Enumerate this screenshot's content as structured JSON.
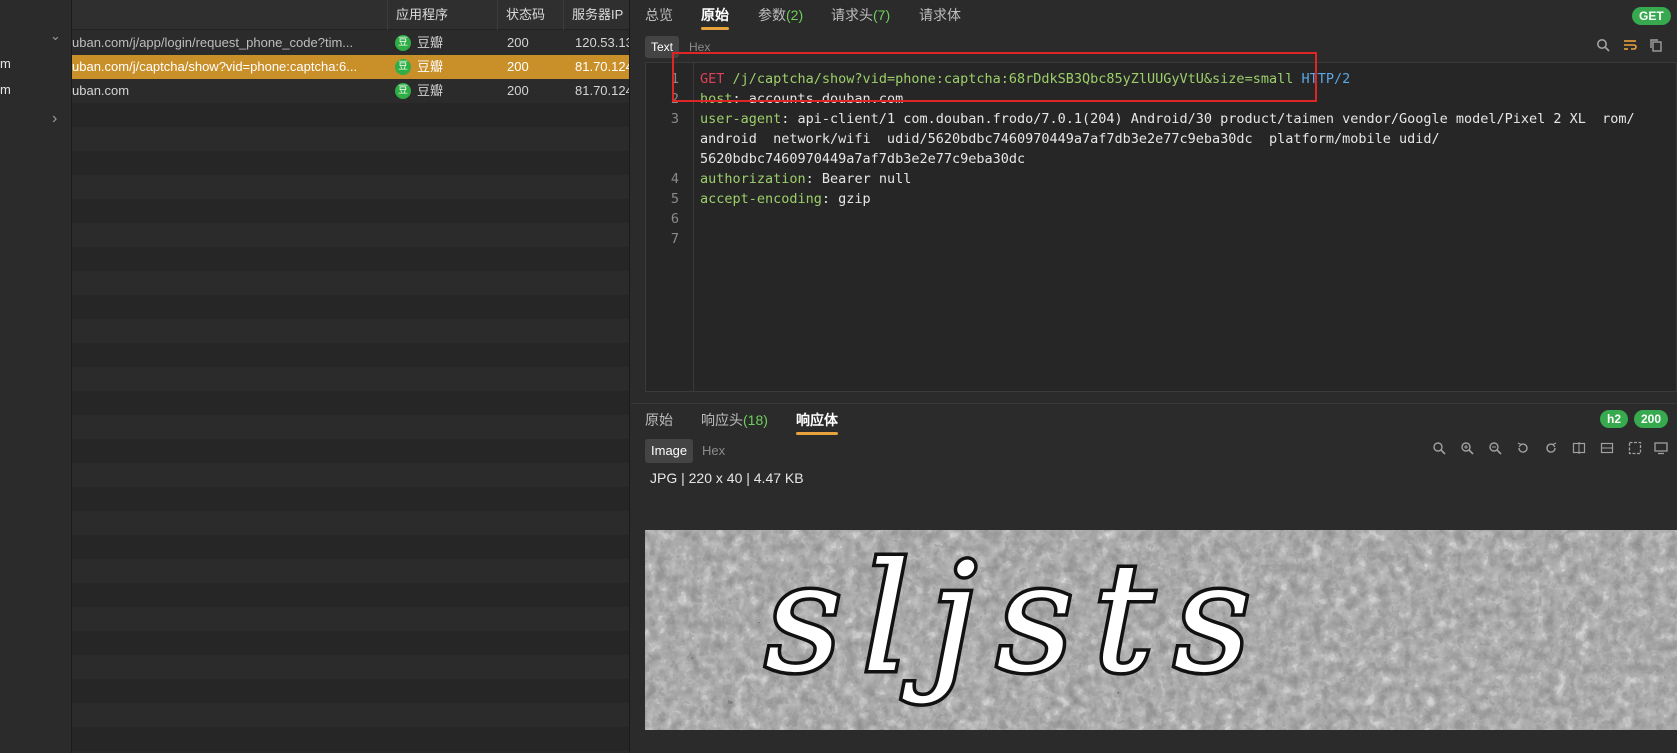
{
  "sidebar": {
    "chevron_down": "⌄",
    "chevron_right": "›",
    "fragments": [
      "m",
      "m"
    ]
  },
  "list": {
    "columns": [
      "应用程序",
      "状态码",
      "服务器IP"
    ],
    "rows": [
      {
        "url": "uban.com/j/app/login/request_phone_code?tim...",
        "app_icon": "豆",
        "app": "豆瓣",
        "status": "200",
        "ip": "120.53.13"
      },
      {
        "url": "uban.com/j/captcha/show?vid=phone:captcha:6...",
        "app_icon": "豆",
        "app": "豆瓣",
        "status": "200",
        "ip": "81.70.124"
      },
      {
        "url": "uban.com",
        "app_icon": "豆",
        "app": "豆瓣",
        "status": "200",
        "ip": "81.70.124"
      }
    ]
  },
  "request": {
    "tabs": [
      {
        "label": "总览",
        "count": ""
      },
      {
        "label": "原始",
        "count": ""
      },
      {
        "label": "参数",
        "count": "(2)"
      },
      {
        "label": "请求头",
        "count": "(7)"
      },
      {
        "label": "请求体",
        "count": ""
      }
    ],
    "method_badge": "GET",
    "subtabs": [
      "Text",
      "Hex"
    ],
    "icons": [
      "search-icon",
      "wrap-icon",
      "copy-icon"
    ],
    "lines": {
      "l1": {
        "method": "GET",
        "path": " /j/captcha/show?vid=phone:captcha:68rDdkSB3Qbc85yZlUUGyVtU&size=small",
        "proto": " HTTP/2"
      },
      "l2": {
        "key": "host",
        "val": ": accounts.douban.com"
      },
      "l3": {
        "key": "user-agent",
        "val": ": api-client/1 com.douban.frodo/7.0.1(204) Android/30 product/taimen vendor/Google model/Pixel 2 XL  rom/"
      },
      "l3b": "android  network/wifi  udid/5620bdbc7460970449a7af7db3e2e77c9eba30dc  platform/mobile udid/",
      "l3c": "5620bdbc7460970449a7af7db3e2e77c9eba30dc",
      "l4": {
        "key": "authorization",
        "val": ": Bearer null"
      },
      "l5": {
        "key": "accept-encoding",
        "val": ": gzip"
      }
    },
    "line_numbers": [
      "1",
      "2",
      "3",
      "4",
      "5",
      "6",
      "7"
    ]
  },
  "response": {
    "tabs": [
      {
        "label": "原始",
        "count": ""
      },
      {
        "label": "响应头",
        "count": "(18)"
      },
      {
        "label": "响应体",
        "count": ""
      }
    ],
    "badges": {
      "proto": "h2",
      "status": "200"
    },
    "subtabs": [
      "Image",
      "Hex"
    ],
    "image_info": "JPG | 220 x 40 | 4.47 KB",
    "captcha_text": "sljsts"
  }
}
